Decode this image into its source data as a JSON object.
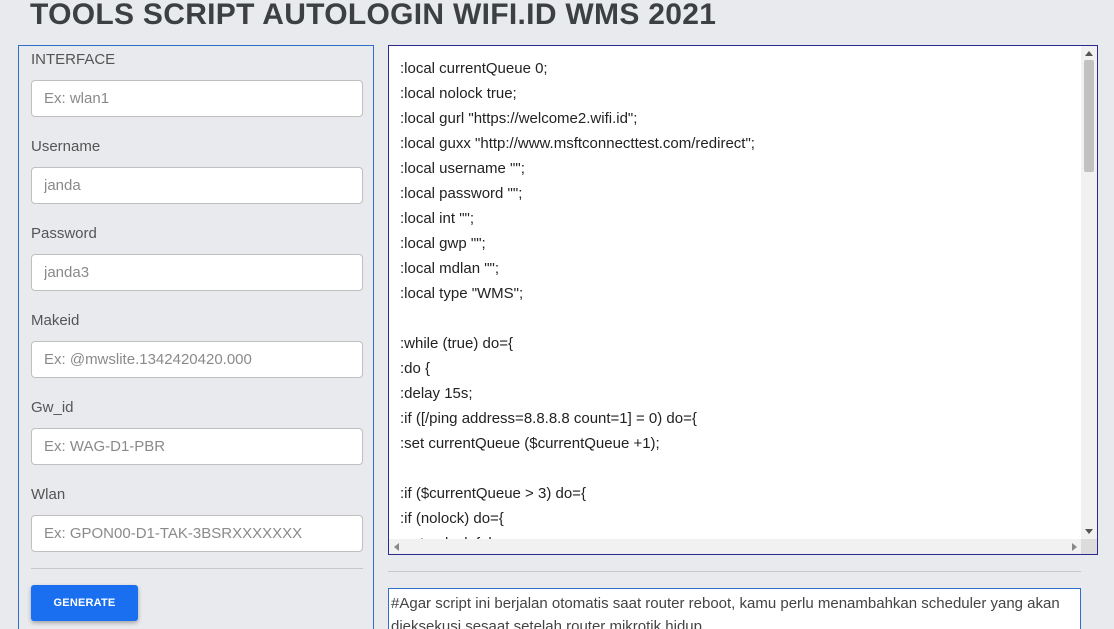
{
  "page": {
    "title": "TOOLS SCRIPT AUTOLOGIN WIFI.ID WMS 2021"
  },
  "form": {
    "fields": [
      {
        "label": "INTERFACE",
        "value": "",
        "placeholder": "Ex: wlan1"
      },
      {
        "label": "Username",
        "value": "",
        "placeholder": "janda"
      },
      {
        "label": "Password",
        "value": "",
        "placeholder": "janda3"
      },
      {
        "label": "Makeid",
        "value": "",
        "placeholder": "Ex: @mwslite.1342420420.000"
      },
      {
        "label": "Gw_id",
        "value": "",
        "placeholder": "Ex: WAG-D1-PBR"
      },
      {
        "label": "Wlan",
        "value": "",
        "placeholder": "Ex: GPON00-D1-TAK-3BSRXXXXXXX"
      }
    ],
    "generate_label": "GENERATE"
  },
  "script": {
    "text": ":local currentQueue 0;\n:local nolock true;\n:local gurl \"https://welcome2.wifi.id\";\n:local guxx \"http://www.msftconnecttest.com/redirect\";\n:local username \"\";\n:local password \"\";\n:local int \"\";\n:local gwp \"\";\n:local mdlan \"\";\n:local type \"WMS\";\n\n:while (true) do={\n:do {\n:delay 15s;\n:if ([/ping address=8.8.8.8 count=1] = 0) do={\n:set currentQueue ($currentQueue +1);\n\n:if ($currentQueue > 3) do={\n:if (nolock) do={\n:set nolock false;"
  },
  "note": {
    "text": "#Agar script ini berjalan otomatis saat router reboot, kamu perlu menambahkan scheduler yang akan dieksekusi sesaat setelah router mikrotik hidup"
  },
  "colors": {
    "accent": "#1a6ff0",
    "panel_border": "#2f6fc9",
    "script_border": "#2a2a8f",
    "background": "#e8eaed"
  }
}
